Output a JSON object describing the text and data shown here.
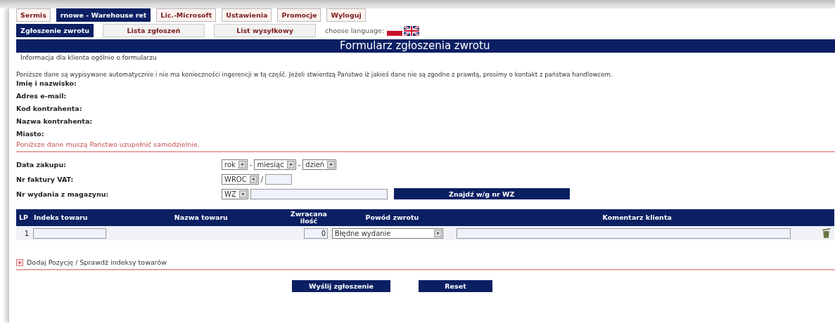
{
  "top_nav": [
    {
      "label": "Sermis",
      "selected": false
    },
    {
      "label": "rnowe - Warehouse ret",
      "selected": true
    },
    {
      "label": "Lic.-Microsoft",
      "selected": false
    },
    {
      "label": "Ustawienia",
      "selected": false
    },
    {
      "label": "Promocje",
      "selected": false
    },
    {
      "label": "Wyloguj",
      "selected": false
    }
  ],
  "sub_nav": [
    {
      "label": "Zgłoszenie zwrotu",
      "selected": true
    },
    {
      "label": "Lista zgłoszeń",
      "selected": false
    },
    {
      "label": "List wysyłkowy",
      "selected": false
    }
  ],
  "language": {
    "label": "choose language:",
    "flags": [
      {
        "kind": "pl"
      },
      {
        "kind": "uk"
      }
    ]
  },
  "form_title": "Formularz zgłoszenia zwrotu",
  "info_link": "Informacja dla klienta ogólnie o formularzu",
  "auto_notice": "Poniższe dane są wypisywane automatycznie i nie ma konieczności ingerencji w tą część. Jeżeli stwierdzą Państwo iż jakieś dane nie są zgodne z prawdą, prosimy o kontakt z państwa handlowcem.",
  "customer_fields": [
    "Imię i nazwisko:",
    "Adres e-mail:",
    "Kod kontrahenta:",
    "Nazwa kontrahenta:",
    "Miasto:"
  ],
  "manual_notice": "Poniższe dane muszą Państwo uzupełnić samodzielnie.",
  "purchase_date": {
    "label": "Data zakupu:",
    "parts": [
      {
        "kind": "select",
        "text": "rok"
      },
      {
        "kind": "sep",
        "text": "-"
      },
      {
        "kind": "select",
        "text": "miesiąc"
      },
      {
        "kind": "sep",
        "text": "-"
      },
      {
        "kind": "select",
        "text": "dzień"
      }
    ]
  },
  "invoice": {
    "label": "Nr faktury VAT:",
    "parts": [
      {
        "kind": "select",
        "text": "WROC"
      },
      {
        "kind": "sep",
        "text": "/"
      },
      {
        "kind": "shortfield"
      }
    ]
  },
  "wz": {
    "label": "Nr wydania z magazynu:",
    "parts": [
      {
        "kind": "select",
        "text": "WZ"
      },
      {
        "kind": "longfield"
      },
      {
        "kind": "button",
        "text": "Znajdź w/g nr WZ"
      }
    ]
  },
  "table": {
    "columns": [
      "LP",
      "Indeks towaru",
      "Nazwa towaru",
      "Zwracana ilość",
      "Powód zwrotu",
      "Komentarz klienta"
    ],
    "rows": [
      {
        "lp": "1",
        "quantity": "0",
        "reason": "Błędne wydanie"
      }
    ]
  },
  "add_link": "Dodaj Pozycję / Sprawdź indeksy towarów",
  "buttons": [
    "Wyślij zgłoszenie",
    "Reset"
  ]
}
